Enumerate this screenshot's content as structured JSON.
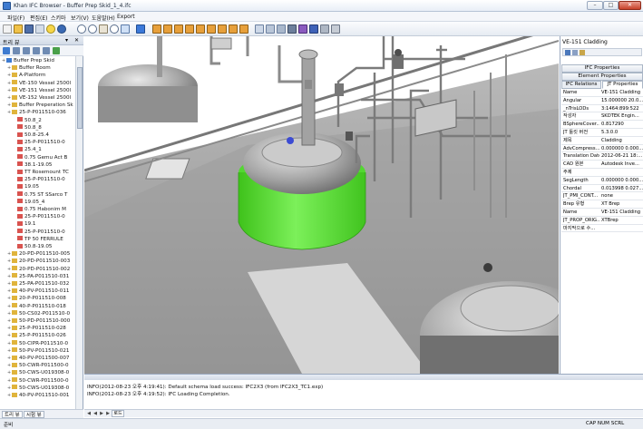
{
  "window": {
    "title": "Khan IFC Browser - Buffer Prep Skid_1_4.ifc",
    "controls": [
      "minimize",
      "maximize",
      "close"
    ]
  },
  "menu": [
    "파일(F)",
    "편집(E)",
    "스키마",
    "보기(V)",
    "도움말(H)",
    "Export"
  ],
  "left_panel": {
    "header": "트리 뷰",
    "tree": [
      {
        "label": "Buffer Prep Skid",
        "level": 0,
        "type": "root"
      },
      {
        "label": "Buffer Room",
        "level": 1,
        "type": "folder"
      },
      {
        "label": "A-Platform",
        "level": 1,
        "type": "folder"
      },
      {
        "label": "VE-150 Vessel 2500l",
        "level": 1,
        "type": "folder"
      },
      {
        "label": "VE-151 Vessel 2500l",
        "level": 1,
        "type": "folder"
      },
      {
        "label": "VE-152 Vessel 2500l",
        "level": 1,
        "type": "folder"
      },
      {
        "label": "Buffer Preperation Sk",
        "level": 1,
        "type": "folder"
      },
      {
        "label": "25-P-P011510-036",
        "level": 1,
        "type": "folder"
      },
      {
        "label": "50.8_2",
        "level": 2,
        "type": "item"
      },
      {
        "label": "50.8_8",
        "level": 2,
        "type": "item"
      },
      {
        "label": "50.8-25.4",
        "level": 2,
        "type": "item"
      },
      {
        "label": "25-P-P011510-0",
        "level": 2,
        "type": "item"
      },
      {
        "label": "25.4_1",
        "level": 2,
        "type": "item"
      },
      {
        "label": "0.75 Gemu Act B",
        "level": 2,
        "type": "item"
      },
      {
        "label": "38.1-19.05",
        "level": 2,
        "type": "item"
      },
      {
        "label": "TT Rosemount TC",
        "level": 2,
        "type": "item"
      },
      {
        "label": "25-P-P011510-0",
        "level": 2,
        "type": "item"
      },
      {
        "label": "19.05",
        "level": 2,
        "type": "item"
      },
      {
        "label": "0.75 ST SSarco T",
        "level": 2,
        "type": "item"
      },
      {
        "label": "19.05_4",
        "level": 2,
        "type": "item"
      },
      {
        "label": "0.75 Habonim M",
        "level": 2,
        "type": "item"
      },
      {
        "label": "25-P-P011510-0",
        "level": 2,
        "type": "item"
      },
      {
        "label": "19.1",
        "level": 2,
        "type": "item"
      },
      {
        "label": "25-P-P011510-0",
        "level": 2,
        "type": "item"
      },
      {
        "label": "TP 50 FERRULE",
        "level": 2,
        "type": "item"
      },
      {
        "label": "50.8-19.05",
        "level": 2,
        "type": "item"
      },
      {
        "label": "20-PD-P011510-005",
        "level": 1,
        "type": "folder"
      },
      {
        "label": "20-PD-P011510-003",
        "level": 1,
        "type": "folder"
      },
      {
        "label": "20-PD-P011510-002",
        "level": 1,
        "type": "folder"
      },
      {
        "label": "25-PA-P011510-031",
        "level": 1,
        "type": "folder"
      },
      {
        "label": "25-PA-P011510-032",
        "level": 1,
        "type": "folder"
      },
      {
        "label": "40-PV-P011510-011",
        "level": 1,
        "type": "folder"
      },
      {
        "label": "20-P-P011510-008",
        "level": 1,
        "type": "folder"
      },
      {
        "label": "40-P-P011510-018",
        "level": 1,
        "type": "folder"
      },
      {
        "label": "50-CS02-P011510-0",
        "level": 1,
        "type": "folder"
      },
      {
        "label": "50-PD-P011510-000",
        "level": 1,
        "type": "folder"
      },
      {
        "label": "25-P-P011510-028",
        "level": 1,
        "type": "folder"
      },
      {
        "label": "25-P-P011510-026",
        "level": 1,
        "type": "folder"
      },
      {
        "label": "50-CIPR-P011510-0",
        "level": 1,
        "type": "folder"
      },
      {
        "label": "50-PV-P011510-021",
        "level": 1,
        "type": "folder"
      },
      {
        "label": "40-PV-P011500-007",
        "level": 1,
        "type": "folder"
      },
      {
        "label": "50-CWR-P011500-0",
        "level": 1,
        "type": "folder"
      },
      {
        "label": "50-CWS-U019308-0",
        "level": 1,
        "type": "folder"
      },
      {
        "label": "50-CWR-P011500-0",
        "level": 1,
        "type": "folder"
      },
      {
        "label": "50-CWS-U019308-0",
        "level": 1,
        "type": "folder"
      },
      {
        "label": "40-PV-P011510-001",
        "level": 1,
        "type": "folder"
      }
    ]
  },
  "bottom_tabs": [
    "트리 뷰",
    "시험 뷰"
  ],
  "right_panel": {
    "title": "VE-151 Cladding",
    "buttons": [
      "IFC Properties",
      "Element Properties"
    ],
    "tabs": [
      "IFC Relations",
      "JT Properties"
    ],
    "properties": [
      {
        "k": "Name",
        "v": "VE-151 Cladding"
      },
      {
        "k": "Angular",
        "v": "15.000000 20.0..."
      },
      {
        "k": "_nTrisLODs",
        "v": "3:1464:899:522"
      },
      {
        "k": "작성자",
        "v": "SKDTEK Engin..."
      },
      {
        "k": "BSphereCover...",
        "v": "0.817290"
      },
      {
        "k": "JT 툴킷 버전",
        "v": "5.3.0.0"
      },
      {
        "k": "제목",
        "v": "Cladding"
      },
      {
        "k": "AdvCompress...",
        "v": "0.000000 0.000..."
      },
      {
        "k": "Translation Date",
        "v": "2012-06-21 18:..."
      },
      {
        "k": "CAD 원본",
        "v": "Autodesk Inve..."
      },
      {
        "k": "주제",
        "v": ""
      },
      {
        "k": "SegLength",
        "v": "0.000000 0.000..."
      },
      {
        "k": "Chordal",
        "v": "0.013998 0.027..."
      },
      {
        "k": "JT_PMI_CONT...",
        "v": "none"
      },
      {
        "k": "Brep 유형",
        "v": "XT Brep"
      },
      {
        "k": "Name",
        "v": "VE-151 Cladding"
      },
      {
        "k": "JT_PROP_ORIG...",
        "v": "XTBrep"
      },
      {
        "k": "마지막으로 수...",
        "v": ""
      }
    ]
  },
  "log": {
    "lines": [
      "INFO(2012-08-23 오후 4:19:41): Default schema load success: IFC2X3 (from IFC2X3_TC1.exp)",
      "INFO(2012-08-23 오후 4:19:52): IFC Loading Completion."
    ],
    "tab": "로드"
  },
  "status": {
    "left": "준비",
    "right": "CAP  NUM  SCRL"
  },
  "colors": {
    "highlight": "#5ee23a",
    "accent": "#3e7bd0",
    "viewport_bg": "#ffffff"
  }
}
